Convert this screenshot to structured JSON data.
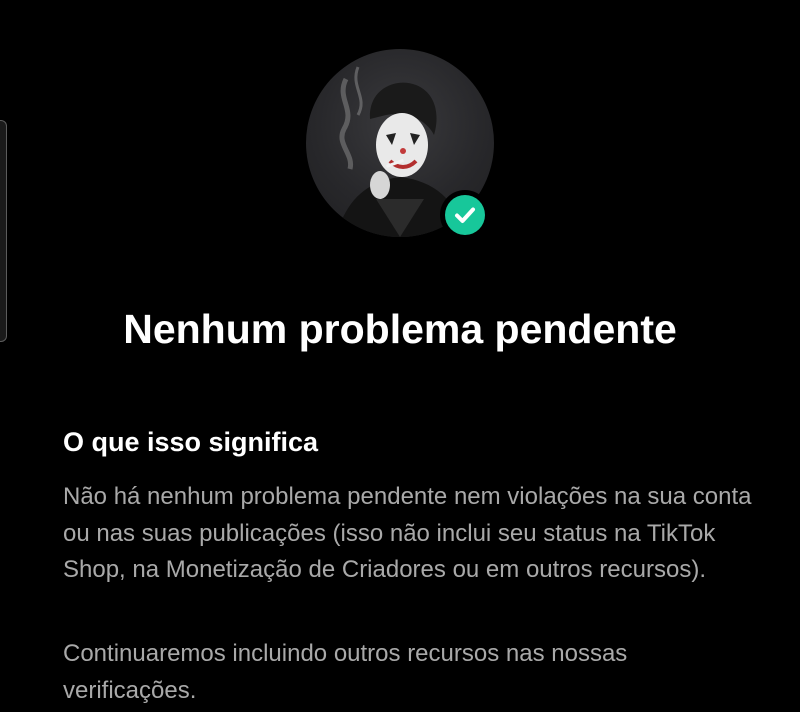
{
  "status": {
    "title": "Nenhum problema pendente",
    "verified": true
  },
  "profile": {
    "avatar": "profile-avatar-photo",
    "badge_icon": "check-icon",
    "badge_color": "#17c79a"
  },
  "info": {
    "heading": "O que isso significa",
    "paragraph_1": "Não há nenhum problema pendente nem violações na sua conta ou nas suas publicações (isso não inclui seu status na TikTok Shop, na Monetização de Criadores ou em outros recursos).",
    "paragraph_2": "Continuaremos incluindo outros recursos nas nossas verificações."
  },
  "colors": {
    "background": "#000000",
    "title": "#ffffff",
    "body_text": "#a9a9a9"
  }
}
